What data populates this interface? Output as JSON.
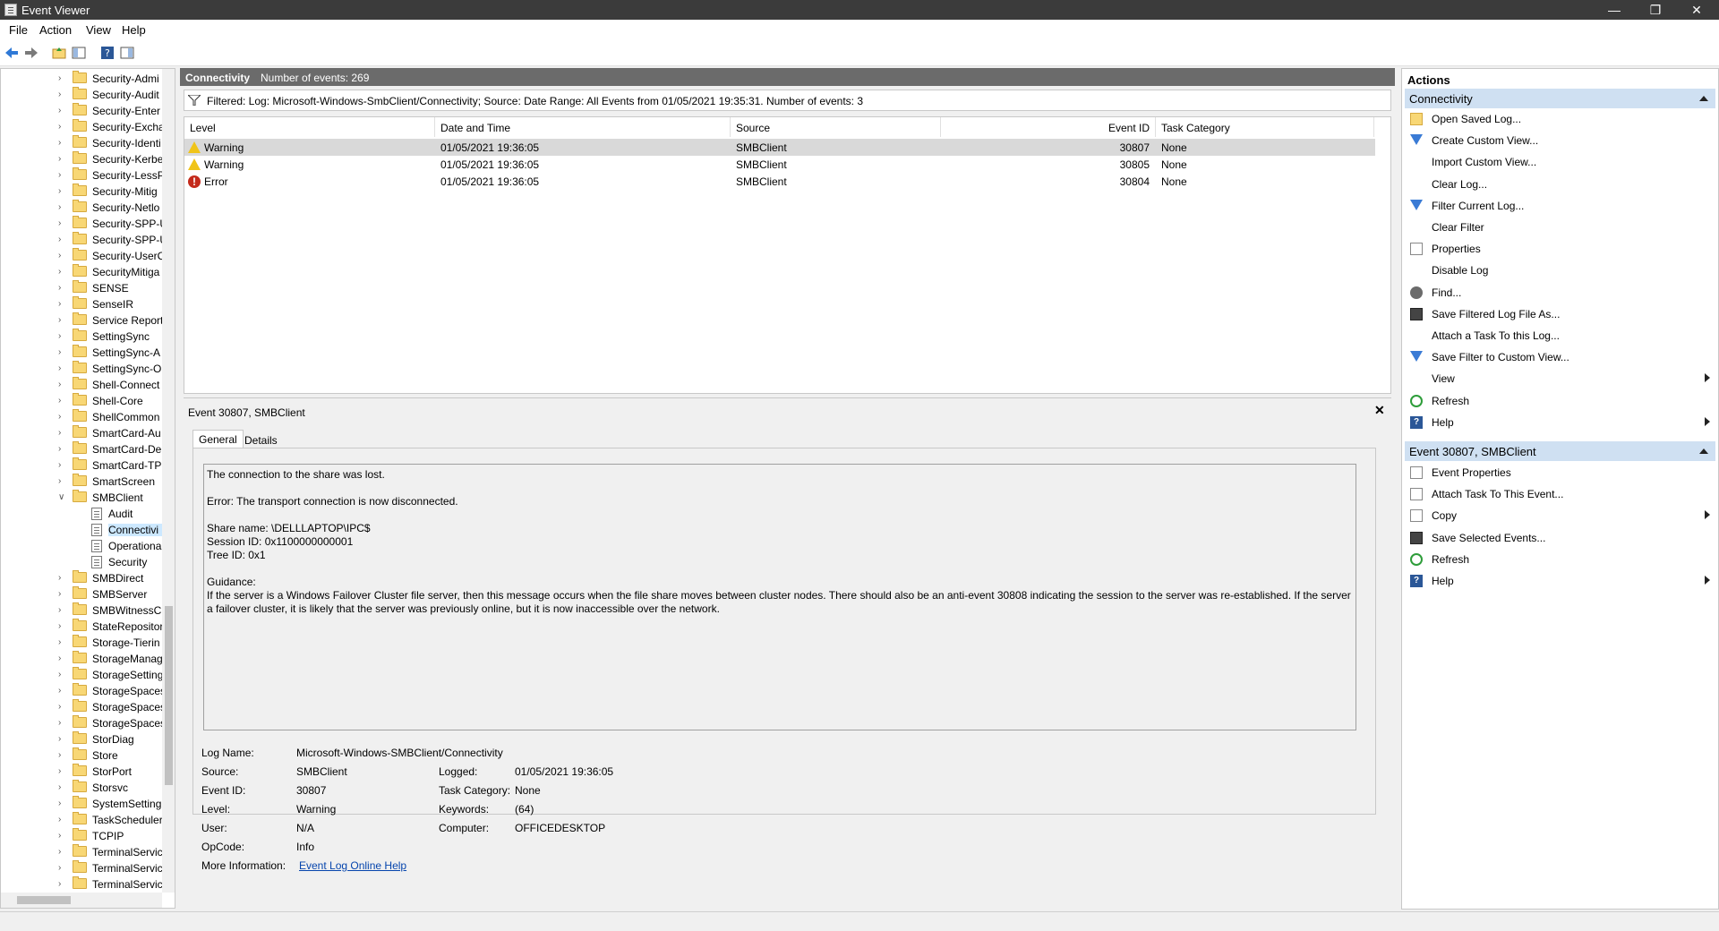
{
  "window": {
    "title": "Event Viewer"
  },
  "menu": [
    "File",
    "Action",
    "View",
    "Help"
  ],
  "tree": {
    "items": [
      {
        "label": "Security-Admi",
        "expanded": false
      },
      {
        "label": "Security-Audit",
        "expanded": false
      },
      {
        "label": "Security-Enter",
        "expanded": false
      },
      {
        "label": "Security-Excha",
        "expanded": false
      },
      {
        "label": "Security-Identi",
        "expanded": false
      },
      {
        "label": "Security-Kerbe",
        "expanded": false
      },
      {
        "label": "Security-LessP",
        "expanded": false
      },
      {
        "label": "Security-Mitig",
        "expanded": false
      },
      {
        "label": "Security-Netlo",
        "expanded": false
      },
      {
        "label": "Security-SPP-U",
        "expanded": false
      },
      {
        "label": "Security-SPP-U",
        "expanded": false
      },
      {
        "label": "Security-UserC",
        "expanded": false
      },
      {
        "label": "SecurityMitiga",
        "expanded": false
      },
      {
        "label": "SENSE",
        "expanded": false
      },
      {
        "label": "SenseIR",
        "expanded": false
      },
      {
        "label": "Service Report",
        "expanded": false
      },
      {
        "label": "SettingSync",
        "expanded": false
      },
      {
        "label": "SettingSync-A",
        "expanded": false
      },
      {
        "label": "SettingSync-O",
        "expanded": false
      },
      {
        "label": "Shell-Connect",
        "expanded": false
      },
      {
        "label": "Shell-Core",
        "expanded": false
      },
      {
        "label": "ShellCommon",
        "expanded": false
      },
      {
        "label": "SmartCard-Au",
        "expanded": false
      },
      {
        "label": "SmartCard-De",
        "expanded": false
      },
      {
        "label": "SmartCard-TPI",
        "expanded": false
      },
      {
        "label": "SmartScreen",
        "expanded": false
      },
      {
        "label": "SMBClient",
        "expanded": true
      }
    ],
    "children": [
      "Audit",
      "Connectivi",
      "Operationa",
      "Security"
    ],
    "items_after": [
      "SMBDirect",
      "SMBServer",
      "SMBWitnessCl",
      "StateRepositor",
      "Storage-Tierin",
      "StorageManag",
      "StorageSetting",
      "StorageSpaces",
      "StorageSpaces",
      "StorageSpaces",
      "StorDiag",
      "Store",
      "StorPort",
      "Storsvc",
      "SystemSetting",
      "TaskScheduler",
      "TCPIP",
      "TerminalServic",
      "TerminalServic",
      "TerminalServic"
    ]
  },
  "log": {
    "name": "Connectivity",
    "count_text": "Number of events: 269",
    "filter_text": "Filtered: Log: Microsoft-Windows-SmbClient/Connectivity; Source: Date Range: All Events from 01/05/2021 19:35:31. Number of events: 3"
  },
  "columns": [
    "Level",
    "Date and Time",
    "Source",
    "Event ID",
    "Task Category"
  ],
  "events": [
    {
      "level": "Warning",
      "datetime": "01/05/2021 19:36:05",
      "source": "SMBClient",
      "id": "30807",
      "category": "None"
    },
    {
      "level": "Warning",
      "datetime": "01/05/2021 19:36:05",
      "source": "SMBClient",
      "id": "30805",
      "category": "None"
    },
    {
      "level": "Error",
      "datetime": "01/05/2021 19:36:05",
      "source": "SMBClient",
      "id": "30804",
      "category": "None"
    }
  ],
  "details": {
    "title": "Event 30807, SMBClient",
    "tabs": [
      "General",
      "Details"
    ],
    "desc": [
      "The connection to the share was lost.",
      "Error: The transport connection is now disconnected.",
      "Share name: \\DELLLAPTOP\\IPC$",
      "Session ID: 0x1100000000001",
      "Tree ID: 0x1",
      "Guidance:",
      "If the server is a Windows Failover Cluster file server, then this message occurs when the file share moves between cluster nodes. There should also be an anti-event 30808 indicating the session to the server was re-established. If the server is not",
      "a failover cluster, it is likely that the server was previously online, but it is now inaccessible over the network."
    ],
    "props": {
      "log_name_label": "Log Name:",
      "log_name": "Microsoft-Windows-SMBClient/Connectivity",
      "source_label": "Source:",
      "source": "SMBClient",
      "logged_label": "Logged:",
      "logged": "01/05/2021 19:36:05",
      "event_id_label": "Event ID:",
      "event_id": "30807",
      "task_label": "Task Category:",
      "task": "None",
      "level_label": "Level:",
      "level": "Warning",
      "keywords_label": "Keywords:",
      "keywords": "(64)",
      "user_label": "User:",
      "user": "N/A",
      "computer_label": "Computer:",
      "computer": "OFFICEDESKTOP",
      "opcode_label": "OpCode:",
      "opcode": "Info",
      "more_label": "More Information:",
      "more_link": "Event Log Online Help"
    }
  },
  "actions": {
    "header": "Actions",
    "section1": "Connectivity",
    "items1": [
      {
        "label": "Open Saved Log...",
        "icon": "folder-icon",
        "sub": false
      },
      {
        "label": "Create Custom View...",
        "icon": "filter-icon",
        "sub": false
      },
      {
        "label": "Import Custom View...",
        "icon": "",
        "sub": false
      },
      {
        "label": "Clear Log...",
        "icon": "",
        "sub": false
      },
      {
        "label": "Filter Current Log...",
        "icon": "filter-icon",
        "sub": false
      },
      {
        "label": "Clear Filter",
        "icon": "",
        "sub": false
      },
      {
        "label": "Properties",
        "icon": "properties-icon",
        "sub": false
      },
      {
        "label": "Disable Log",
        "icon": "",
        "sub": false
      },
      {
        "label": "Find...",
        "icon": "find-icon",
        "sub": false
      },
      {
        "label": "Save Filtered Log File As...",
        "icon": "save-icon",
        "sub": false
      },
      {
        "label": "Attach a Task To this Log...",
        "icon": "",
        "sub": false
      },
      {
        "label": "Save Filter to Custom View...",
        "icon": "filter-icon",
        "sub": false
      },
      {
        "label": "View",
        "icon": "",
        "sub": true
      },
      {
        "label": "Refresh",
        "icon": "refresh-icon",
        "sub": false
      },
      {
        "label": "Help",
        "icon": "help-icon",
        "sub": true
      }
    ],
    "section2": "Event 30807, SMBClient",
    "items2": [
      {
        "label": "Event Properties",
        "icon": "properties-icon",
        "sub": false
      },
      {
        "label": "Attach Task To This Event...",
        "icon": "task-icon",
        "sub": false
      },
      {
        "label": "Copy",
        "icon": "copy-icon",
        "sub": true
      },
      {
        "label": "Save Selected Events...",
        "icon": "save-icon",
        "sub": false
      },
      {
        "label": "Refresh",
        "icon": "refresh-icon",
        "sub": false
      },
      {
        "label": "Help",
        "icon": "help-icon",
        "sub": true
      }
    ]
  }
}
